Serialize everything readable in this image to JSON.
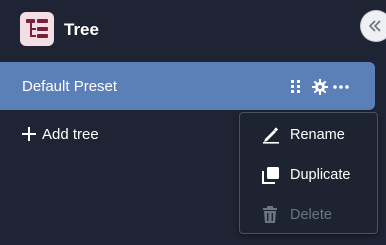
{
  "header": {
    "title": "Tree",
    "logo_icon": "tree-hierarchy-icon",
    "collapse_icon": "double-chevron-left-icon"
  },
  "preset": {
    "label": "Default Preset",
    "icons": [
      "drag-handle-icon",
      "gear-icon",
      "more-horizontal-icon"
    ]
  },
  "add_tree": {
    "label": "Add tree",
    "icon": "plus-icon"
  },
  "context_menu": {
    "items": [
      {
        "label": "Rename",
        "icon": "pencil-icon",
        "enabled": true
      },
      {
        "label": "Duplicate",
        "icon": "copy-icon",
        "enabled": true
      },
      {
        "label": "Delete",
        "icon": "trash-icon",
        "enabled": false
      }
    ]
  },
  "colors": {
    "background": "#1e2433",
    "selected_row": "#5b7fb7",
    "logo_bg": "#f3dee3",
    "logo_fg": "#7a1f3d",
    "disabled_text": "#6d7482"
  }
}
